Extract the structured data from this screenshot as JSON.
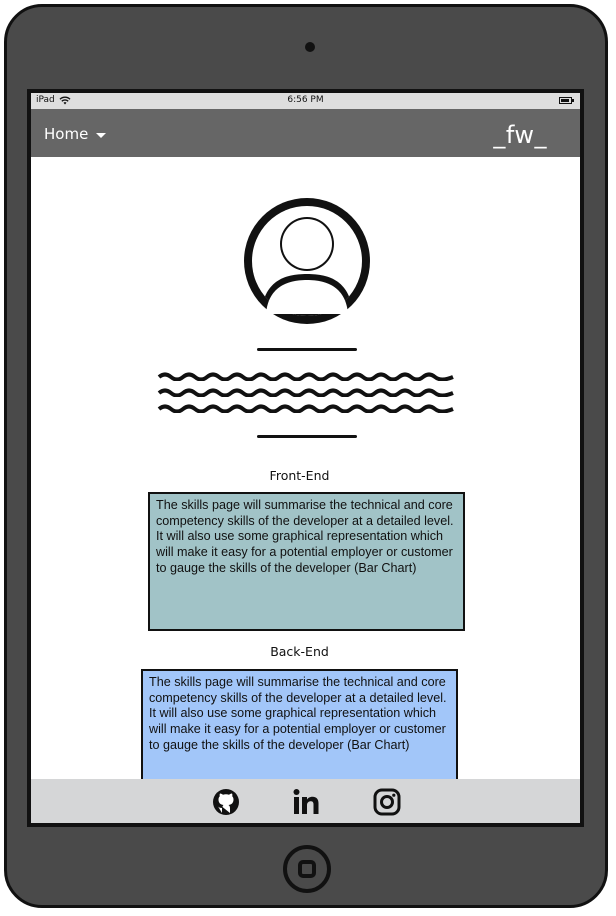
{
  "statusbar": {
    "device": "iPad",
    "time": "6:56 PM"
  },
  "navbar": {
    "home_label": "Home",
    "brand": "_fw_"
  },
  "sections": [
    {
      "heading": "Front-End",
      "text": "The skills page will summarise the technical and core competency skills of the developer at a detailed level. It will also use some graphical representation which will make it easy for a potential employer or customer to gauge the skills of the developer (Bar Chart)",
      "color": "#a1c3c7"
    },
    {
      "heading": "Back-End",
      "text": "The skills page will summarise the technical and core competency skills of the developer at a detailed level. It will also use some graphical representation which will make it easy for a potential employer or customer to gauge the skills of the developer (Bar Chart)",
      "color": "#a2c6f9"
    }
  ],
  "footer": {
    "icons": [
      "github-icon",
      "linkedin-icon",
      "instagram-icon"
    ]
  },
  "colors": {
    "device_body": "#4a4a4a",
    "navbar": "#666666",
    "footer": "#d5d6d7"
  }
}
